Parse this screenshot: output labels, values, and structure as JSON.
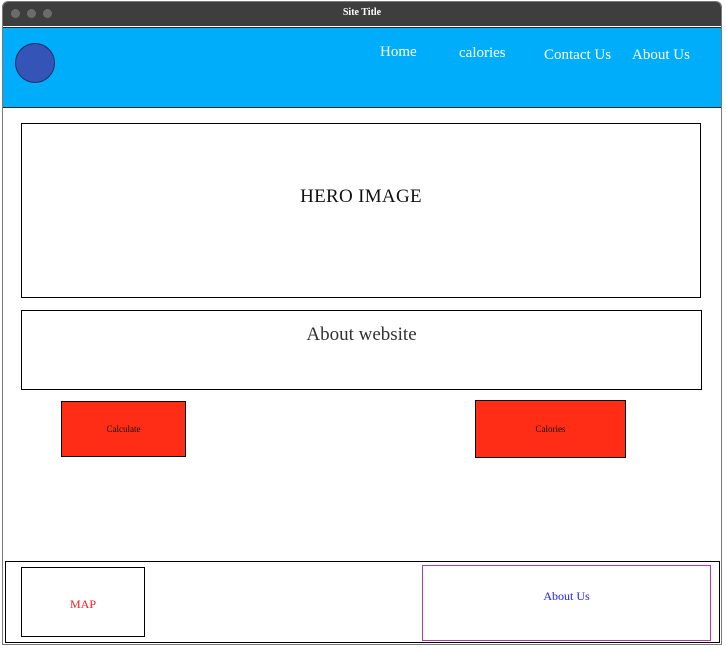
{
  "window": {
    "title": "Site Title"
  },
  "navbar": {
    "logo_icon": "circle-logo-icon",
    "links": [
      {
        "label": "Home"
      },
      {
        "label": "calories"
      },
      {
        "label": "Contact Us"
      },
      {
        "label": "About Us"
      }
    ]
  },
  "hero": {
    "label": "HERO IMAGE"
  },
  "about": {
    "label": "About website"
  },
  "buttons": {
    "calculate_label": "Calculate",
    "calories_label": "Calories"
  },
  "footer": {
    "map_label": "MAP",
    "about_label": "About Us"
  },
  "colors": {
    "navbar_bg": "#00adfa",
    "logo": "#3554b8",
    "button_bg": "#ff2d15",
    "map_text": "#ff1a1a",
    "footer_about_text": "#1a1aff",
    "footer_about_border": "#b03aa8"
  }
}
